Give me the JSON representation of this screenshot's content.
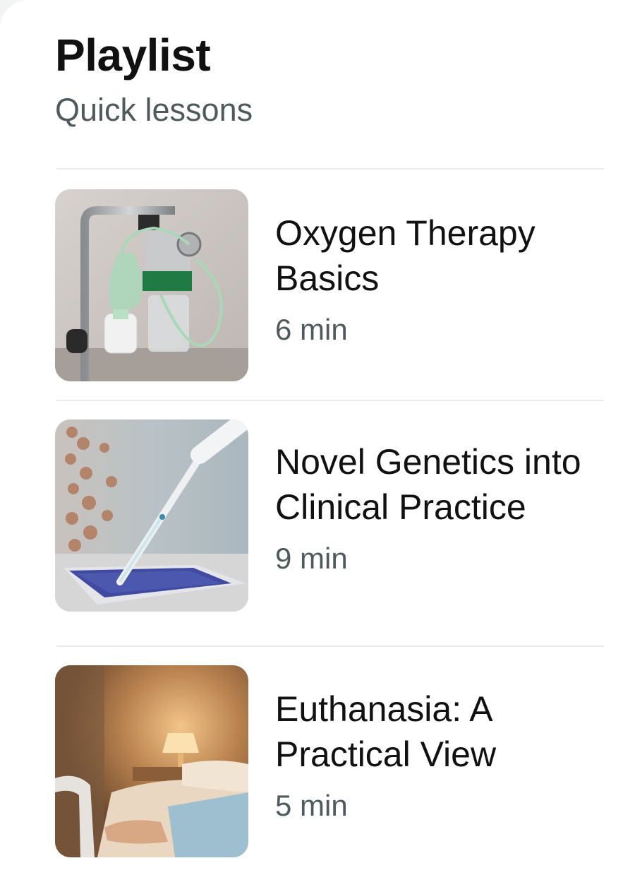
{
  "header": {
    "title": "Playlist",
    "subtitle": "Quick lessons"
  },
  "lessons": [
    {
      "title": "Oxygen Therapy Basics",
      "duration": "6 min",
      "thumbnail": "oxygen-mask-thumbnail"
    },
    {
      "title": "Novel Genetics into Clinical Practice",
      "duration": "9 min",
      "thumbnail": "pipette-dna-thumbnail"
    },
    {
      "title": "Euthanasia: A Practical View",
      "duration": "5 min",
      "thumbnail": "bedside-lamp-thumbnail"
    }
  ]
}
